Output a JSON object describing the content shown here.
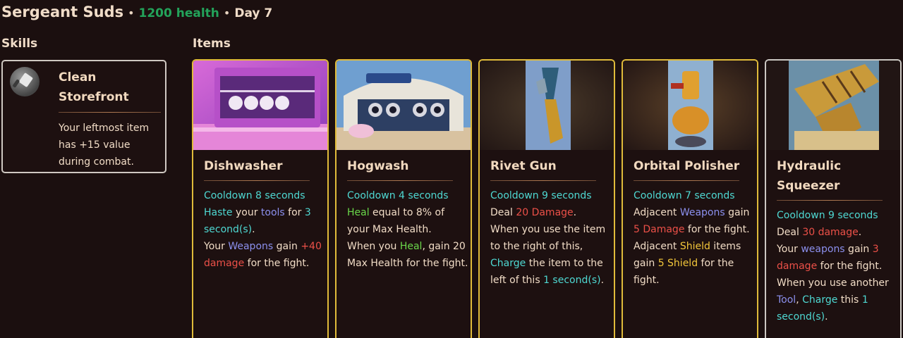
{
  "header": {
    "name": "Sergeant Suds",
    "dot1": "•",
    "health": "1200 health",
    "dot2": "•",
    "day": "Day 7"
  },
  "sections": {
    "skills": "Skills",
    "items": "Items"
  },
  "colors": {
    "background": "#1b0f0f",
    "gold_border": "#e0bb3a",
    "silver_border": "#cbc7c2",
    "cooldown": "#4ed8d2",
    "damage": "#ec5048",
    "tag": "#8c90ee",
    "heal": "#6ad84a",
    "shield": "#f2c63a",
    "health": "#23a35a"
  },
  "skill": {
    "icon": "cleaver-icon",
    "title": "Clean Storefront",
    "description": "Your leftmost item has +15 value during combat."
  },
  "items": [
    {
      "title": "Dishwasher",
      "rarity": "gold",
      "lines": [
        [
          {
            "t": "Cooldown 8 seconds",
            "c": "cyan"
          }
        ],
        [
          {
            "t": "Haste",
            "c": "cyan"
          },
          {
            "t": " your "
          },
          {
            "t": "tools",
            "c": "blue"
          },
          {
            "t": " for "
          },
          {
            "t": "3 second(s)",
            "c": "cyan"
          },
          {
            "t": "."
          }
        ],
        [
          {
            "t": "Your "
          },
          {
            "t": "Weapons",
            "c": "blue"
          },
          {
            "t": " gain "
          },
          {
            "t": "+40 damage",
            "c": "red"
          },
          {
            "t": " for the fight."
          }
        ]
      ]
    },
    {
      "title": "Hogwash",
      "rarity": "gold",
      "lines": [
        [
          {
            "t": "Cooldown 4 seconds",
            "c": "cyan"
          }
        ],
        [
          {
            "t": "Heal",
            "c": "green"
          },
          {
            "t": " equal to 8% of your Max Health."
          }
        ],
        [
          {
            "t": "When you "
          },
          {
            "t": "Heal",
            "c": "green"
          },
          {
            "t": ", gain 20 Max Health for the fight."
          }
        ]
      ]
    },
    {
      "title": "Rivet Gun",
      "rarity": "gold",
      "lines": [
        [
          {
            "t": "Cooldown 9 seconds",
            "c": "cyan"
          }
        ],
        [
          {
            "t": "Deal "
          },
          {
            "t": "20 Damage",
            "c": "red"
          },
          {
            "t": "."
          }
        ],
        [
          {
            "t": "When you use the item to the right of this, "
          },
          {
            "t": "Charge",
            "c": "cyan"
          },
          {
            "t": " the item to the left of this "
          },
          {
            "t": "1 second(s)",
            "c": "cyan"
          },
          {
            "t": "."
          }
        ]
      ]
    },
    {
      "title": "Orbital Polisher",
      "rarity": "gold",
      "lines": [
        [
          {
            "t": "Cooldown 7 seconds",
            "c": "cyan"
          }
        ],
        [
          {
            "t": "Adjacent "
          },
          {
            "t": "Weapons",
            "c": "blue"
          },
          {
            "t": " gain "
          },
          {
            "t": "5 Damage",
            "c": "red"
          },
          {
            "t": " for the fight."
          }
        ],
        [
          {
            "t": "Adjacent "
          },
          {
            "t": "Shield",
            "c": "yellow"
          },
          {
            "t": " items gain "
          },
          {
            "t": "5 Shield",
            "c": "yellow"
          },
          {
            "t": " for the fight."
          }
        ]
      ]
    },
    {
      "title": "Hydraulic Squeezer",
      "rarity": "silver",
      "lines": [
        [
          {
            "t": "Cooldown 9 seconds",
            "c": "cyan"
          }
        ],
        [
          {
            "t": "Deal "
          },
          {
            "t": "30 damage",
            "c": "red"
          },
          {
            "t": "."
          }
        ],
        [
          {
            "t": "Your "
          },
          {
            "t": "weapons",
            "c": "blue"
          },
          {
            "t": " gain "
          },
          {
            "t": "3 damage",
            "c": "red"
          },
          {
            "t": " for the fight."
          }
        ],
        [
          {
            "t": "When you use another "
          },
          {
            "t": "Tool",
            "c": "blue"
          },
          {
            "t": ", "
          },
          {
            "t": "Charge",
            "c": "cyan"
          },
          {
            "t": " this "
          },
          {
            "t": "1 second(s)",
            "c": "cyan"
          },
          {
            "t": "."
          }
        ]
      ]
    }
  ]
}
